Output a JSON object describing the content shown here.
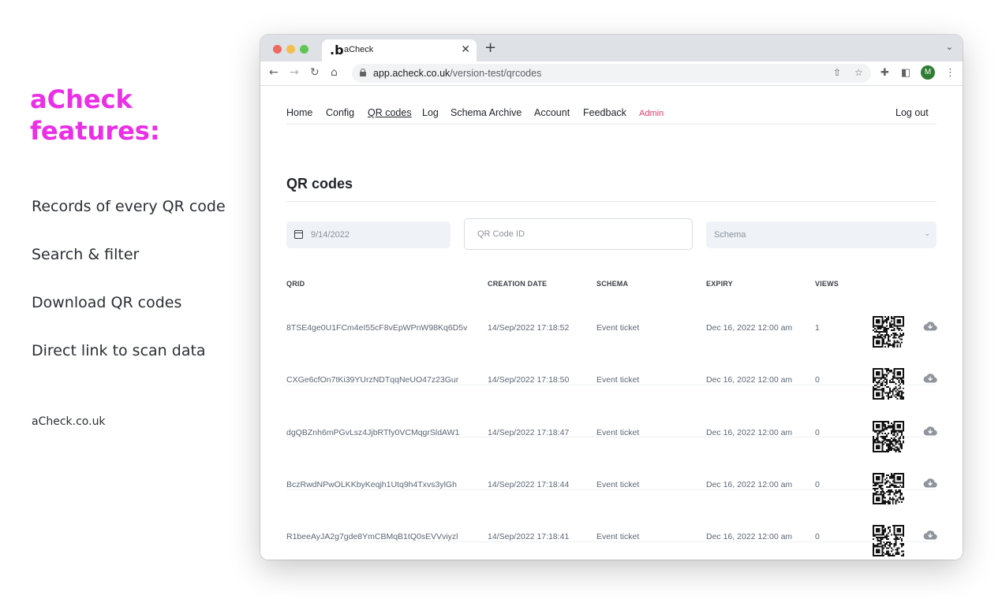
{
  "promo": {
    "title": "aCheck features:",
    "features": [
      "Records of every QR code",
      "Search & filter",
      "Download QR codes",
      "Direct link to scan data"
    ],
    "link": "aCheck.co.uk"
  },
  "browser": {
    "tab_title": "aCheck",
    "tab_favicon": ".b",
    "url_host": "app.acheck.co.uk",
    "url_path": "/version-test/qrcodes",
    "profile_initial": "M"
  },
  "nav": {
    "items": [
      "Home",
      "Config",
      "QR codes",
      "Log",
      "Schema Archive",
      "Account",
      "Feedback"
    ],
    "active": "QR codes",
    "admin": "Admin",
    "logout": "Log out"
  },
  "page": {
    "title": "QR codes",
    "filters": {
      "date_value": "9/14/2022",
      "qr_placeholder": "QR Code ID",
      "schema_placeholder": "Schema"
    },
    "table": {
      "headers": [
        "QRID",
        "CREATION DATE",
        "SCHEMA",
        "EXPIRY",
        "VIEWS"
      ],
      "rows": [
        {
          "qrid": "8TSE4ge0U1FCm4eI55cF8vEpWPnW98Kq6D5v",
          "created": "14/Sep/2022 17:18:52",
          "schema": "Event ticket",
          "expiry": "Dec 16, 2022 12:00 am",
          "views": "1"
        },
        {
          "qrid": "CXGe6cfOn7tKi39YUrzNDTqqNeUO47z23Gur",
          "created": "14/Sep/2022 17:18:50",
          "schema": "Event ticket",
          "expiry": "Dec 16, 2022 12:00 am",
          "views": "0"
        },
        {
          "qrid": "dgQBZnh6mPGvLsz4JjbRTfy0VCMqgrSldAW1",
          "created": "14/Sep/2022 17:18:47",
          "schema": "Event ticket",
          "expiry": "Dec 16, 2022 12:00 am",
          "views": "0"
        },
        {
          "qrid": "BczRwdNPwOLKKbyKeqjh1Utq9h4Txvs3ylGh",
          "created": "14/Sep/2022 17:18:44",
          "schema": "Event ticket",
          "expiry": "Dec 16, 2022 12:00 am",
          "views": "0"
        },
        {
          "qrid": "R1beeAyJA2g7gde8YmCBMqB1tQ0sEVVviyzl",
          "created": "14/Sep/2022 17:18:41",
          "schema": "Event ticket",
          "expiry": "Dec 16, 2022 12:00 am",
          "views": "0"
        }
      ]
    }
  },
  "colors": {
    "brand_magenta": "#ea2fe6",
    "admin_pink": "#e2396b",
    "profile_green": "#2e7d32"
  },
  "icons": [
    "calendar-icon",
    "qr-code-icon",
    "cloud-download-icon",
    "lock-icon",
    "back-icon",
    "forward-icon",
    "reload-icon",
    "home-icon",
    "share-icon",
    "star-icon",
    "extensions-icon",
    "sidepanel-icon",
    "menu-icon"
  ]
}
